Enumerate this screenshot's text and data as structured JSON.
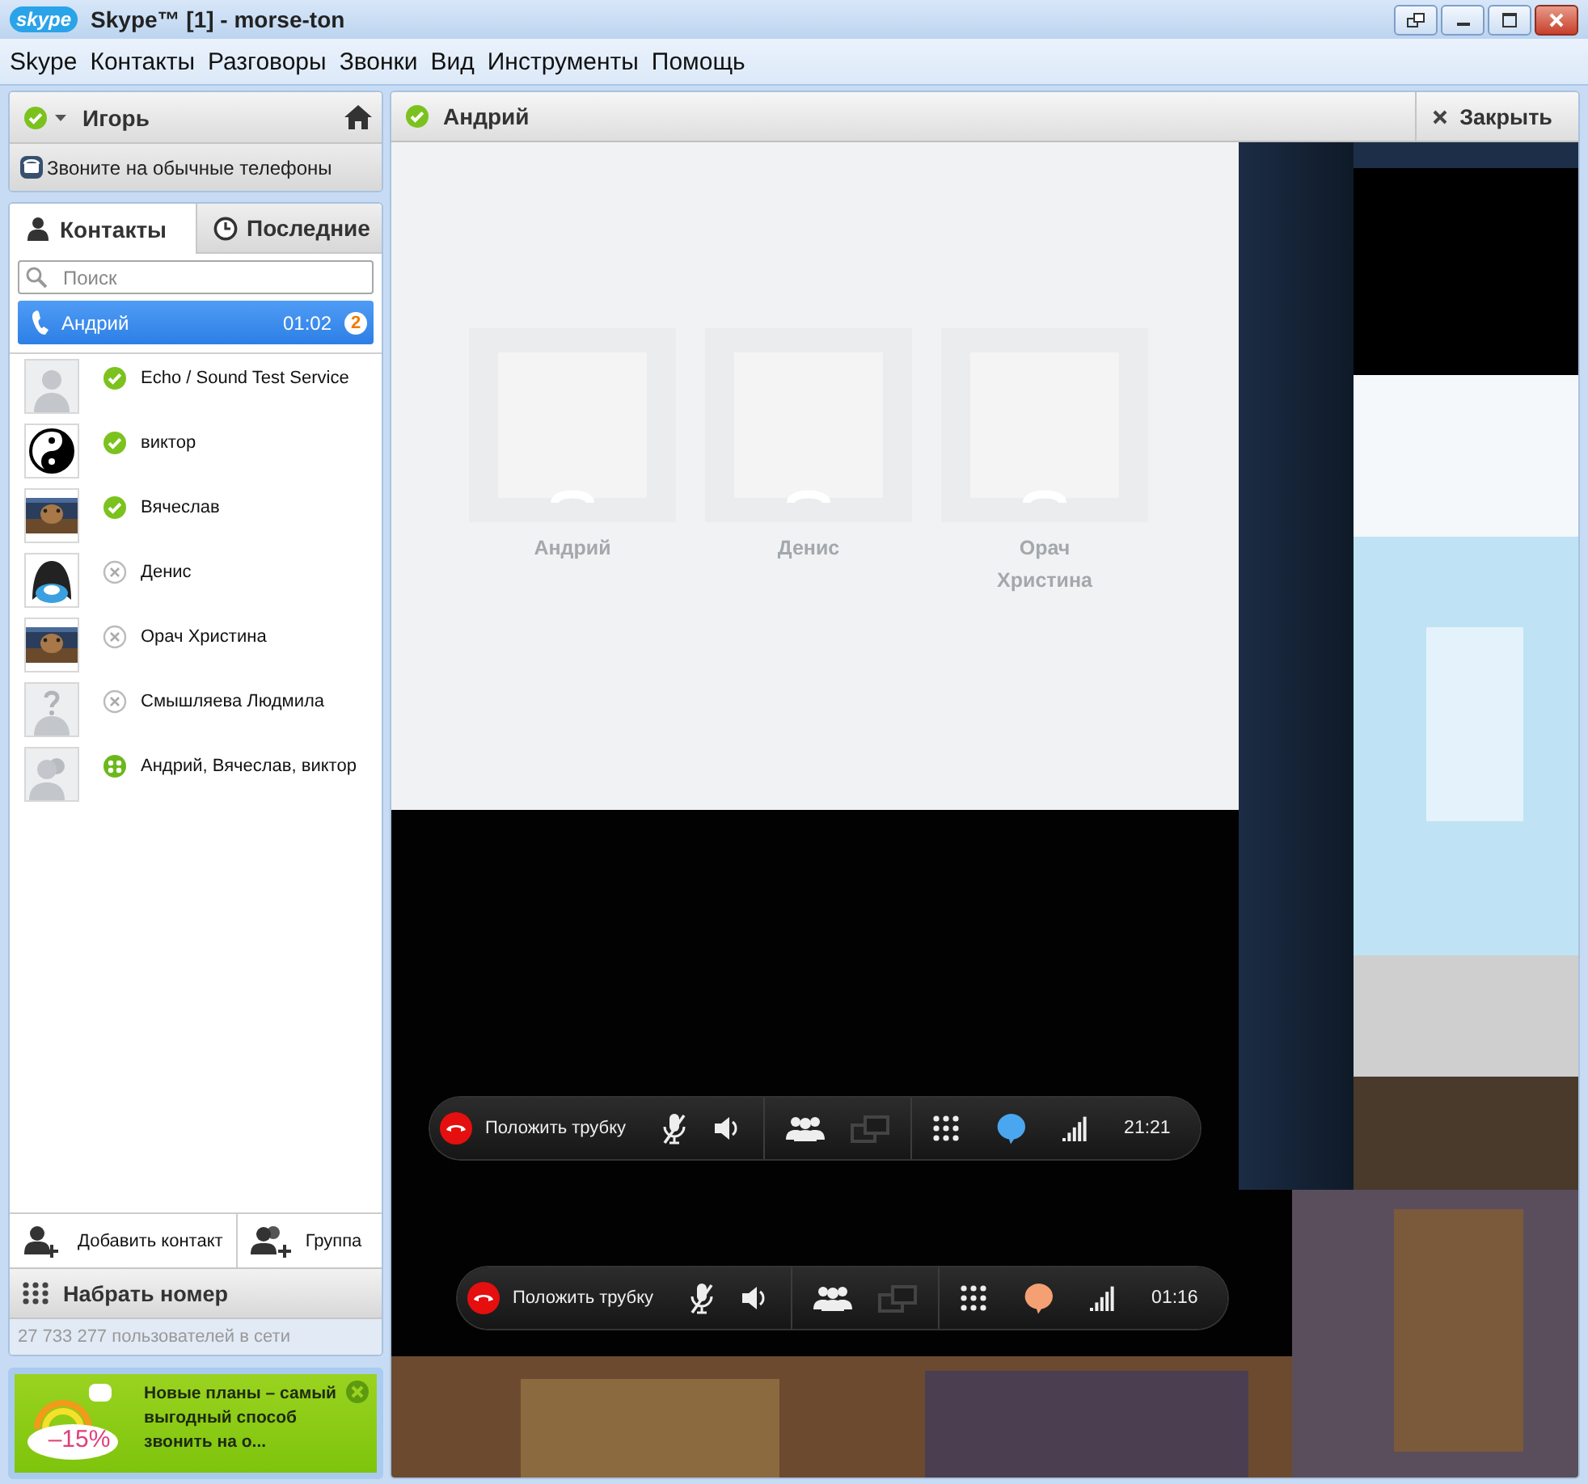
{
  "window": {
    "logo": "skype",
    "title": "Skype™ [1] - morse-ton"
  },
  "menu": [
    "Skype",
    "Контакты",
    "Разговоры",
    "Звонки",
    "Вид",
    "Инструменты",
    "Помощь"
  ],
  "profile": {
    "name": "Игорь",
    "online": true
  },
  "phones_link": "Звоните на обычные телефоны",
  "tabs": [
    {
      "label": "Контакты",
      "selected": true
    },
    {
      "label": "Последние",
      "selected": false
    }
  ],
  "search": {
    "placeholder": "Поиск"
  },
  "active_call": {
    "name": "Андрий",
    "duration": "01:02",
    "badge": "2",
    "selected": true
  },
  "contacts": [
    {
      "name": "Echo / Sound Test Service",
      "kind": "online"
    },
    {
      "name": "виктор",
      "kind": "online"
    },
    {
      "name": "Вячеслав",
      "kind": "online"
    },
    {
      "name": "Денис",
      "kind": "offline"
    },
    {
      "name": "Орач Христина",
      "kind": "offline"
    },
    {
      "name": "Смышляева Людмила",
      "kind": "offline"
    },
    {
      "name": "Андрий, Вячеслав, виктор",
      "kind": "group"
    }
  ],
  "actions": [
    {
      "label": "Добавить контакт"
    },
    {
      "label": "Группа"
    }
  ],
  "dial": "Набрать номер",
  "online_count": "27 733 277 пользователей в сети",
  "ad": {
    "badge": "–15%",
    "text": "Новые планы – самый выгодный способ звонить на о..."
  },
  "conversation": {
    "title": "Андрий",
    "online": true,
    "close": "Закрыть",
    "participants": [
      {
        "name": "Андрий"
      },
      {
        "name": "Денис"
      },
      {
        "name": "Орач Христина"
      }
    ],
    "call_bars": [
      {
        "hangup": "Положить трубку",
        "color": "#4aa6ee",
        "time": "21:21"
      },
      {
        "hangup": "Положить трубку",
        "color": "#f4a072",
        "time": "01:16"
      }
    ]
  }
}
